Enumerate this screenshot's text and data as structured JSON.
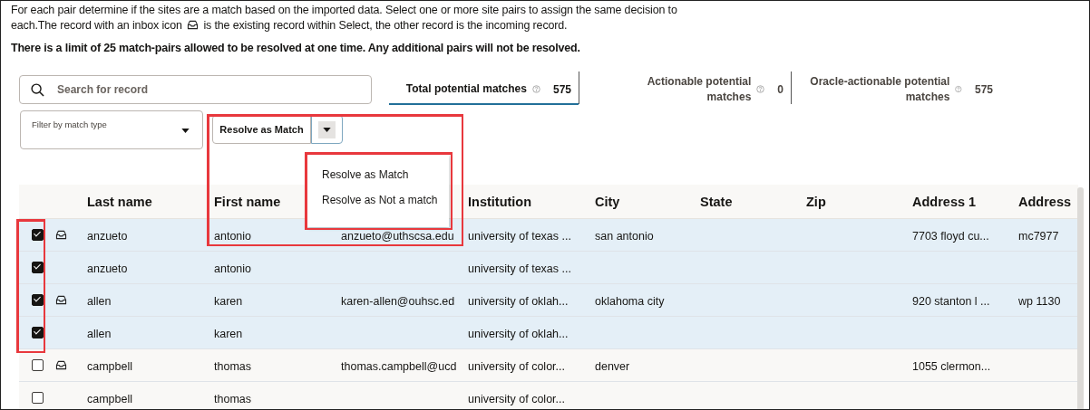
{
  "instructions": {
    "text_before_icon": "For each pair determine if the sites are a match based on the imported data. Select one or more site pairs to assign the same decision to each.The record with an inbox icon",
    "text_after_icon": "is the existing record within Select, the other record is the incoming record.",
    "limit_note": "There is a limit of 25 match-pairs allowed to be resolved at one time. Any additional pairs will not be resolved."
  },
  "search": {
    "placeholder": "Search for record"
  },
  "tabs": [
    {
      "label": "Total potential matches",
      "count": "575",
      "selected": true
    },
    {
      "label": "Actionable potential matches",
      "count": "0",
      "selected": false
    },
    {
      "label": "Oracle-actionable potential matches",
      "count": "575",
      "selected": false
    }
  ],
  "filter": {
    "placeholder": "Filter by match type"
  },
  "resolve_button": {
    "label": "Resolve as Match"
  },
  "menu": {
    "items": [
      "Resolve as Match",
      "Resolve as Not a match"
    ]
  },
  "table": {
    "columns": [
      "Last name",
      "First name",
      "Institution",
      "City",
      "State",
      "Zip",
      "Address 1",
      "Address"
    ],
    "rows": [
      {
        "selected": true,
        "existing": true,
        "last_name": "anzueto",
        "first_name": "antonio",
        "email": "anzueto@uthscsa.edu",
        "institution": "university of texas ...",
        "city": "san antonio",
        "address_1": "7703 floyd cu...",
        "address_2": "mc7977"
      },
      {
        "selected": true,
        "existing": false,
        "last_name": "anzueto",
        "first_name": "antonio",
        "institution": "university of texas ..."
      },
      {
        "selected": true,
        "existing": true,
        "last_name": "allen",
        "first_name": "karen",
        "email": "karen-allen@ouhsc.ed",
        "institution": "university of oklah...",
        "city": "oklahoma city",
        "address_1": "920 stanton l ...",
        "address_2": "wp 1130"
      },
      {
        "selected": true,
        "existing": false,
        "last_name": "allen",
        "first_name": "karen",
        "institution": "university of oklah..."
      },
      {
        "selected": false,
        "existing": true,
        "last_name": "campbell",
        "first_name": "thomas",
        "email": "thomas.campbell@ucd",
        "institution": "university of color...",
        "city": "denver",
        "address_1": "1055 clermon..."
      },
      {
        "selected": false,
        "existing": false,
        "last_name": "campbell",
        "first_name": "thomas",
        "institution": "university of color..."
      }
    ]
  }
}
